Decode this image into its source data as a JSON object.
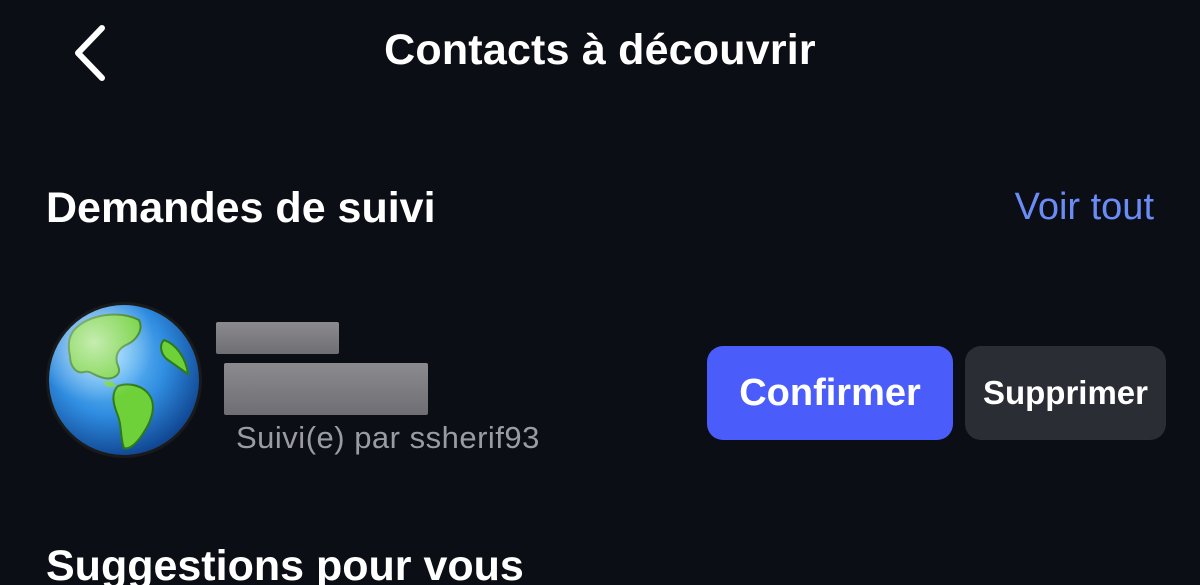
{
  "header": {
    "title": "Contacts à découvrir",
    "back_icon": "chevron-left-icon"
  },
  "follow_requests": {
    "title": "Demandes de suivi",
    "see_all_label": "Voir tout",
    "see_all_color": "#6b8cf7",
    "items": [
      {
        "avatar_icon": "globe-icon",
        "username_redacted": true,
        "fullname_redacted": true,
        "followed_by": "Suivi(e) par ssherif93",
        "confirm_label": "Confirmer",
        "delete_label": "Supprimer"
      }
    ]
  },
  "suggestions": {
    "title": "Suggestions pour vous"
  },
  "colors": {
    "background": "#0b0e14",
    "confirm_button": "#4a5cf9",
    "delete_button": "#2a2d34",
    "secondary_text": "#9a9ca2"
  }
}
